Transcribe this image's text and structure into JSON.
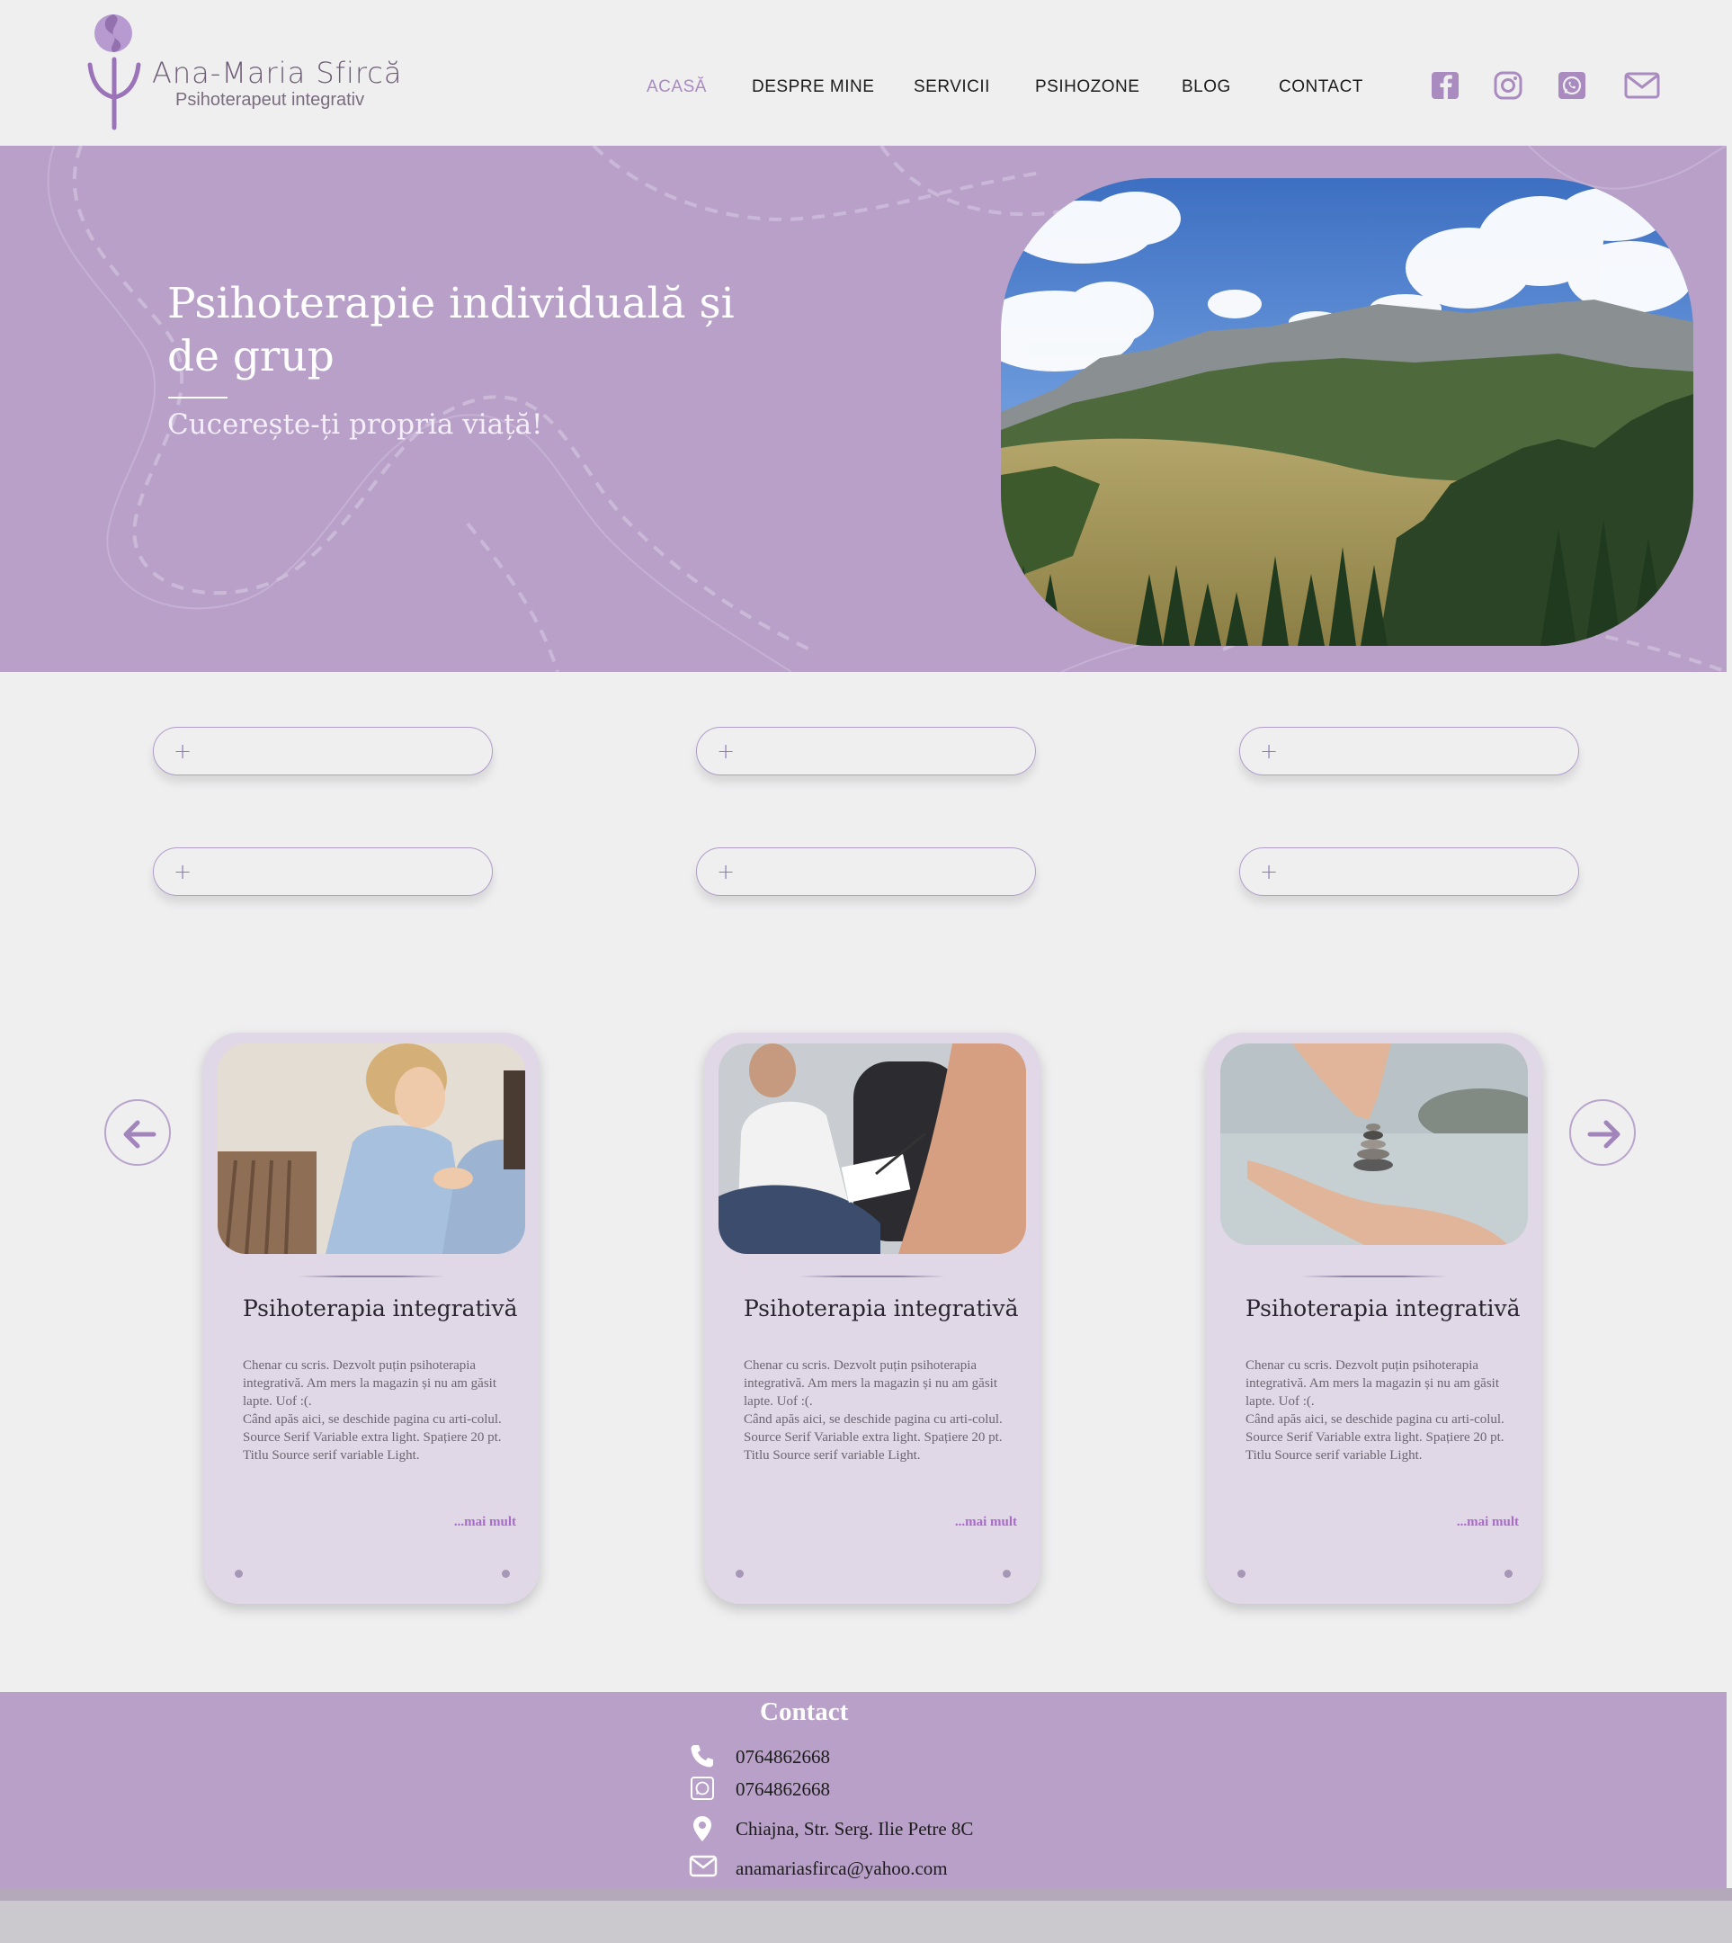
{
  "brand": {
    "name": "Ana-Maria Sfircă",
    "tagline": "Psihoterapeut integrativ"
  },
  "nav": {
    "items": [
      {
        "label": "ACASĂ",
        "active": true
      },
      {
        "label": "DESPRE MINE",
        "active": false
      },
      {
        "label": "SERVICII",
        "active": false
      },
      {
        "label": "PSIHOZONE",
        "active": false
      },
      {
        "label": "BLOG",
        "active": false
      },
      {
        "label": "CONTACT",
        "active": false
      }
    ],
    "social_icons": [
      "facebook-icon",
      "instagram-icon",
      "whatsapp-icon",
      "mail-icon"
    ]
  },
  "hero": {
    "title": "Psihoterapie individuală și de grup",
    "subtitle": "Cucerește-ți propria viață!"
  },
  "pills": [
    {
      "icon": "plus-icon",
      "label": ""
    },
    {
      "icon": "plus-icon",
      "label": ""
    },
    {
      "icon": "plus-icon",
      "label": ""
    },
    {
      "icon": "plus-icon",
      "label": ""
    },
    {
      "icon": "plus-icon",
      "label": ""
    },
    {
      "icon": "plus-icon",
      "label": ""
    }
  ],
  "carousel": {
    "prev_icon": "arrow-left-icon",
    "next_icon": "arrow-right-icon",
    "cards": [
      {
        "title": "Psihoterapia integrativă",
        "text": "Chenar cu scris. Dezvolt puțin psihoterapia integrativă. Am mers la magazin și nu am găsit lapte. Uof :(.\nCând apăs aici, se deschide pagina cu arti-colul.\nSource Serif Variable extra light. Spațiere 20 pt. Titlu Source serif variable Light.",
        "more": "...mai mult"
      },
      {
        "title": "Psihoterapia integrativă",
        "text": "Chenar cu scris. Dezvolt puțin psihoterapia integrativă. Am mers la magazin și nu am găsit lapte. Uof :(.\nCând apăs aici, se deschide pagina cu arti-colul.\nSource Serif Variable extra light. Spațiere 20 pt. Titlu Source serif variable Light.",
        "more": "...mai mult"
      },
      {
        "title": "Psihoterapia integrativă",
        "text": "Chenar cu scris. Dezvolt puțin psihoterapia integrativă. Am mers la magazin și nu am găsit lapte. Uof :(.\nCând apăs aici, se deschide pagina cu arti-colul.\nSource Serif Variable extra light. Spațiere 20 pt. Titlu Source serif variable Light.",
        "more": "...mai mult"
      }
    ]
  },
  "contact": {
    "title": "Contact",
    "phone": "0764862668",
    "whatsapp": "0764862668",
    "address": "Chiajna, Str. Serg. Ilie Petre 8C",
    "email": "anamariasfirca@yahoo.com"
  },
  "colors": {
    "accent": "#b8a0c8",
    "active_nav": "#a98bc0",
    "link": "#a96bc9",
    "card_bg": "#e0d8e6"
  }
}
